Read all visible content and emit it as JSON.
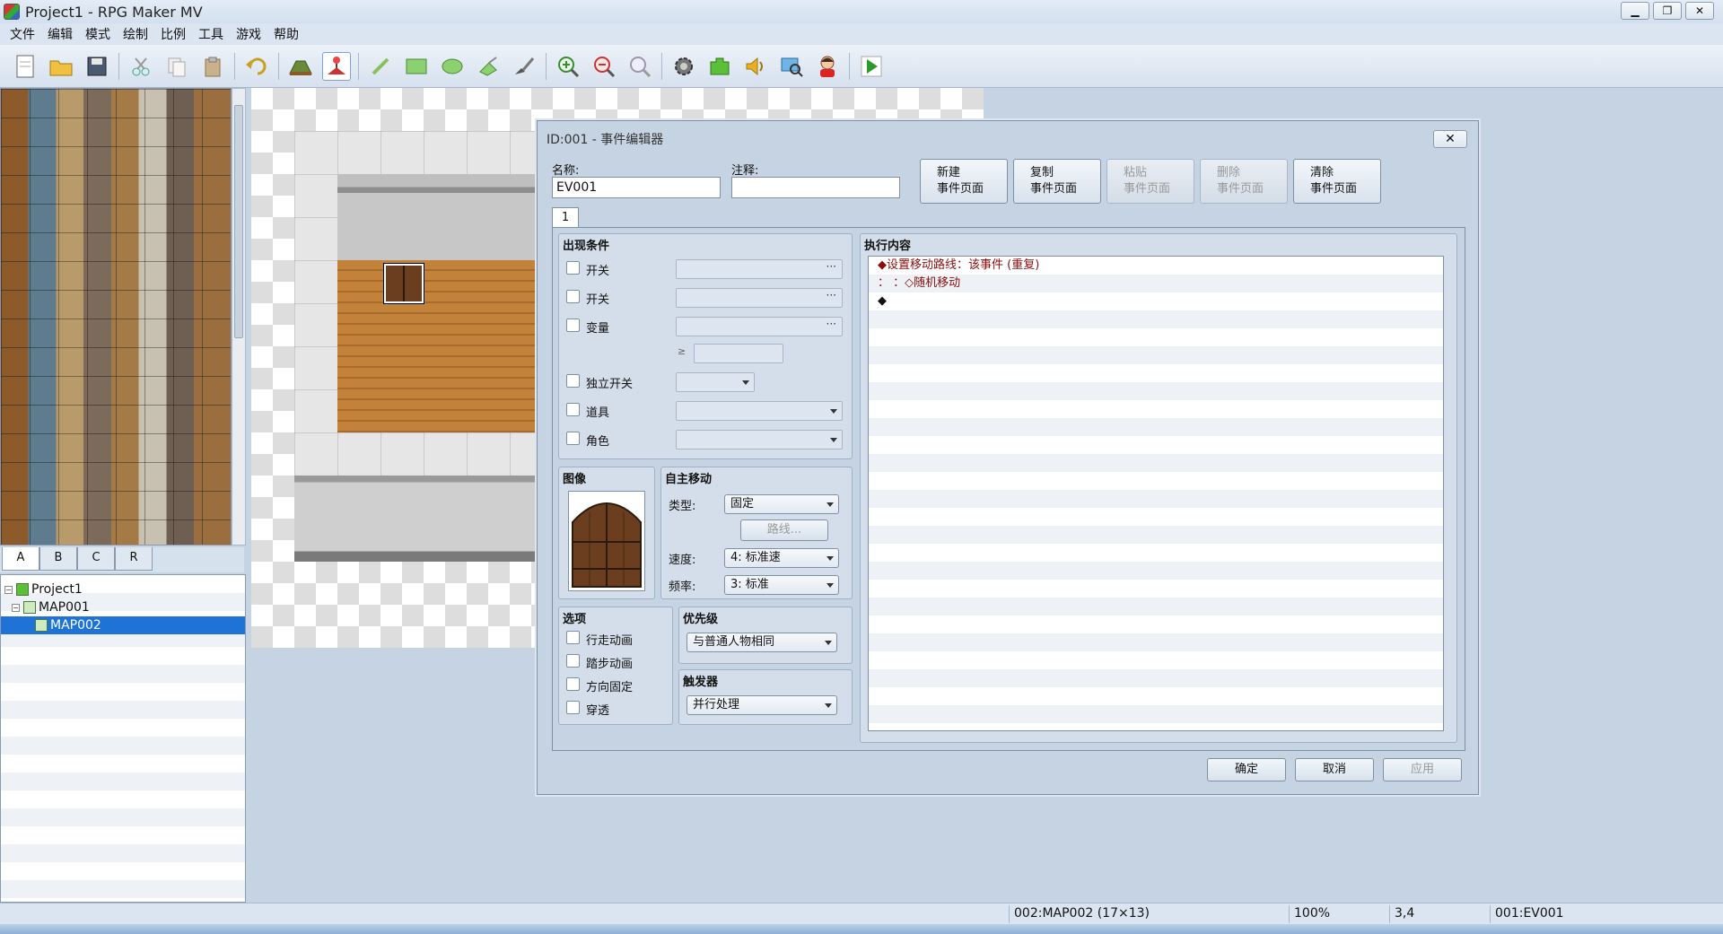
{
  "window": {
    "title": "Project1 - RPG Maker MV",
    "minimize": "▁",
    "restore": "❐",
    "close": "✕"
  },
  "menu": [
    "文件",
    "编辑",
    "模式",
    "绘制",
    "比例",
    "工具",
    "游戏",
    "帮助"
  ],
  "toolbar": {
    "icons": [
      "new-project-icon",
      "open-project-icon",
      "save-project-icon",
      "cut-icon",
      "copy-icon",
      "paste-icon",
      "undo-icon",
      "map-mode-icon",
      "event-mode-icon",
      "pencil-icon",
      "rectangle-icon",
      "ellipse-icon",
      "flood-fill-icon",
      "shadow-pen-icon",
      "zoom-in-icon",
      "zoom-out-icon",
      "actual-size-icon",
      "database-icon",
      "plugin-manager-icon",
      "sound-test-icon",
      "event-searcher-icon",
      "character-generator-icon",
      "playtest-icon"
    ],
    "active": "event-mode-icon"
  },
  "tileset_tabs": [
    "A",
    "B",
    "C",
    "R"
  ],
  "tileset_selected_tab": "A",
  "map_tree": [
    {
      "label": "Project1",
      "level": 0
    },
    {
      "label": "MAP001",
      "level": 1
    },
    {
      "label": "MAP002",
      "level": 2,
      "selected": true
    }
  ],
  "dialog": {
    "title": "ID:001 - 事件编辑器",
    "close": "✕",
    "name_label": "名称:",
    "name_value": "EV001",
    "note_label": "注释:",
    "note_value": "",
    "page_buttons": [
      {
        "line1": "新建",
        "line2": "事件页面",
        "enabled": true
      },
      {
        "line1": "复制",
        "line2": "事件页面",
        "enabled": true
      },
      {
        "line1": "粘贴",
        "line2": "事件页面",
        "enabled": false
      },
      {
        "line1": "删除",
        "line2": "事件页面",
        "enabled": false
      },
      {
        "line1": "清除",
        "line2": "事件页面",
        "enabled": true
      }
    ],
    "page_tab": "1",
    "conditions": {
      "title": "出现条件",
      "switch1": "开关",
      "switch2": "开关",
      "variable": "变量",
      "ge": "≥",
      "self_switch": "独立开关",
      "item": "道具",
      "actor": "角色",
      "dots": "···"
    },
    "image": {
      "title": "图像"
    },
    "autonomous": {
      "title": "自主移动",
      "type_label": "类型:",
      "type_value": "固定",
      "route_button": "路线...",
      "speed_label": "速度:",
      "speed_value": "4: 标准速",
      "freq_label": "频率:",
      "freq_value": "3: 标准"
    },
    "options": {
      "title": "选项",
      "walking": "行走动画",
      "stepping": "踏步动画",
      "dir_fix": "方向固定",
      "through": "穿透"
    },
    "priority": {
      "title": "优先级",
      "value": "与普通人物相同"
    },
    "trigger": {
      "title": "触发器",
      "value": "并行处理"
    },
    "contents": {
      "title": "执行内容",
      "lines": [
        "◆设置移动路线：该事件 (重复)",
        "：                  ：◇随机移动",
        "◆"
      ]
    },
    "footer": {
      "ok": "确定",
      "cancel": "取消",
      "apply": "应用"
    }
  },
  "status": {
    "map": "002:MAP002 (17×13)",
    "zoom": "100%",
    "coords": "3,4",
    "event": "001:EV001"
  }
}
